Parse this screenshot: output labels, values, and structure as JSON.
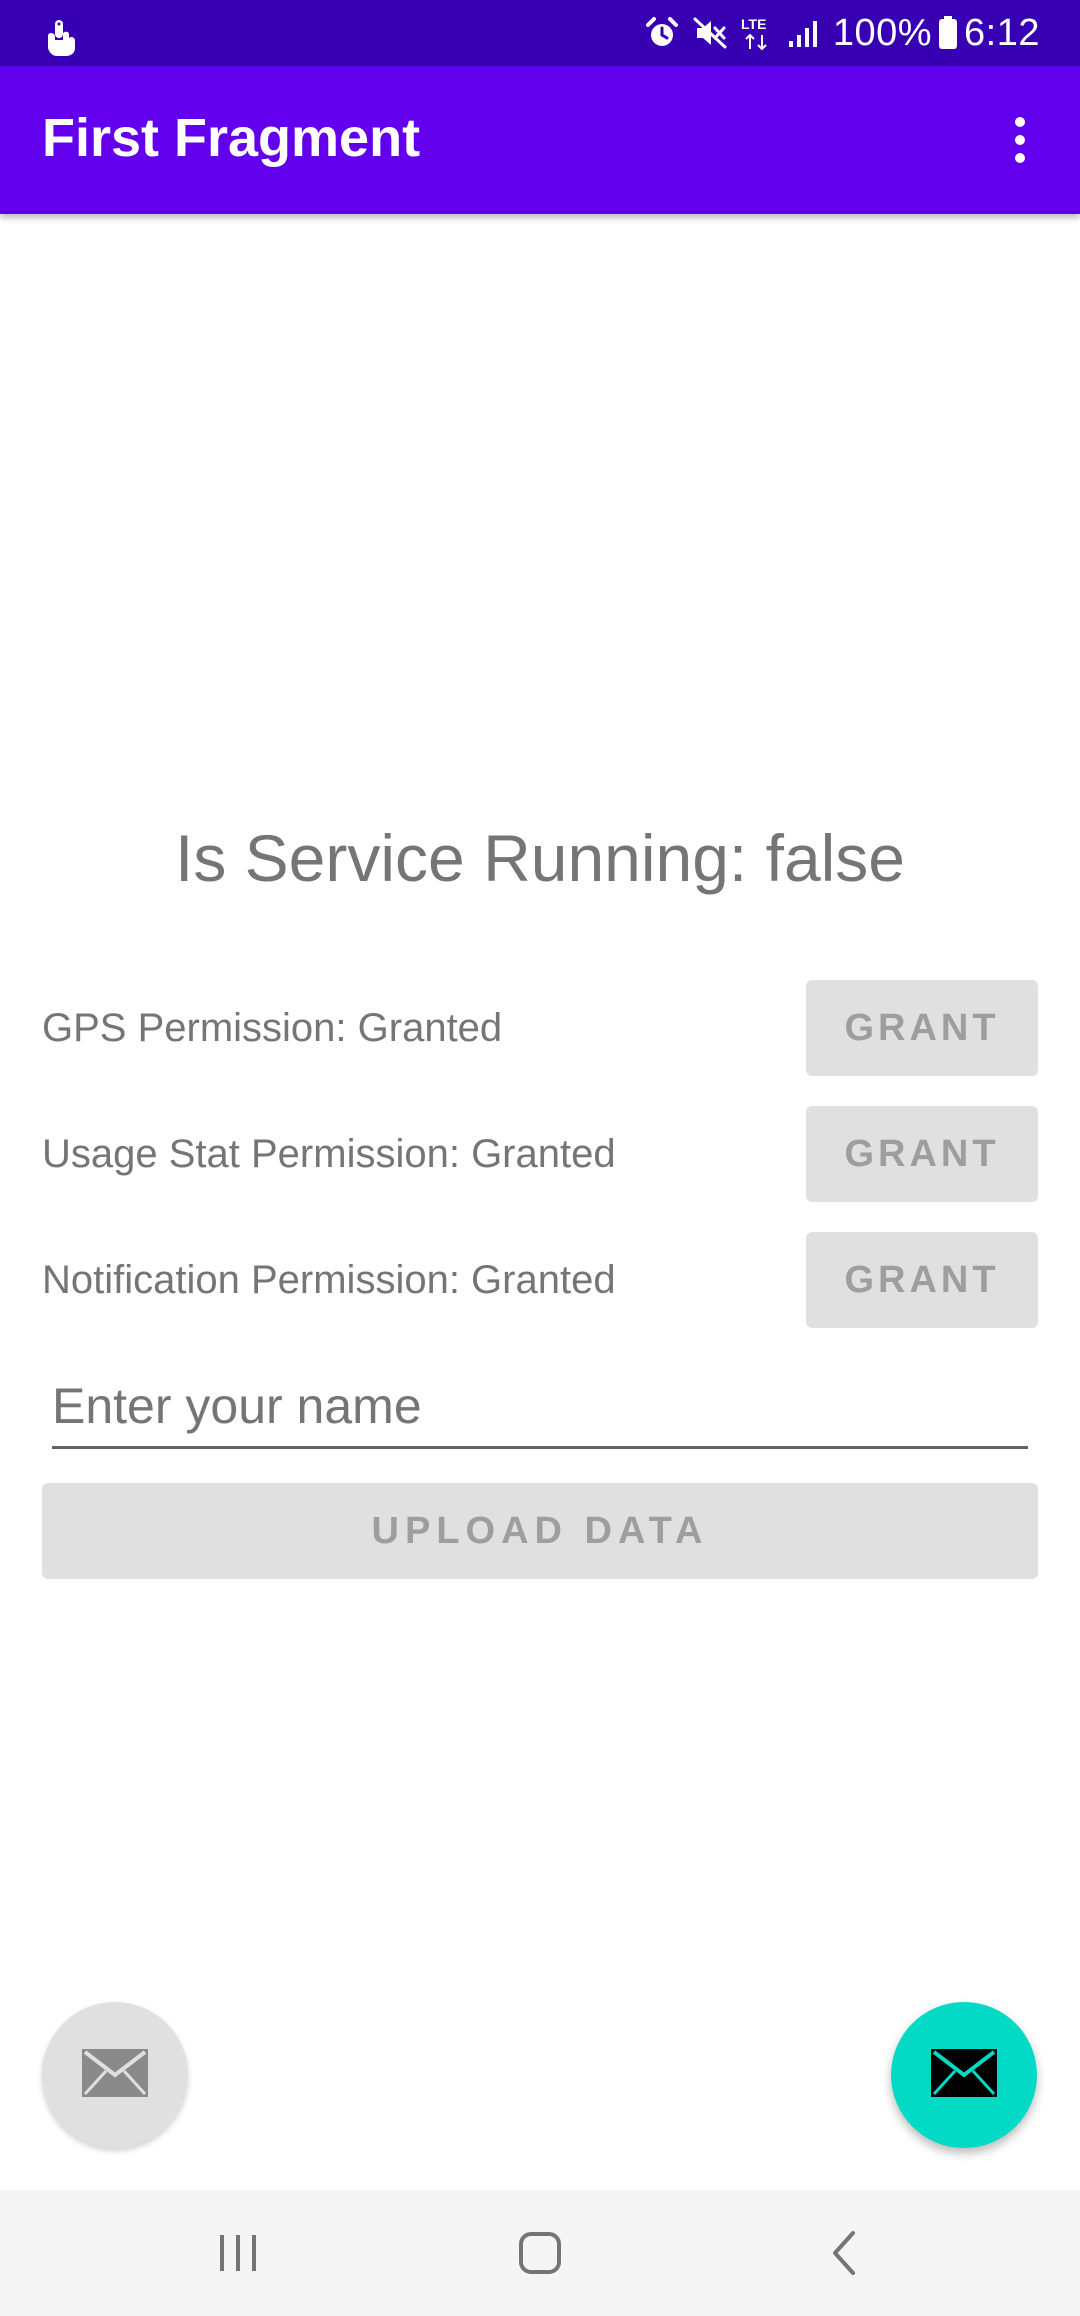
{
  "status_bar": {
    "battery": "100%",
    "time": "6:12",
    "network": "LTE",
    "icons": [
      "touch-hand-icon",
      "alarm-icon",
      "mute-icon",
      "lte-icon",
      "signal-icon",
      "battery-icon"
    ]
  },
  "app_bar": {
    "title": "First Fragment",
    "menu_icon": "overflow-menu-icon"
  },
  "main": {
    "service_status": "Is Service Running: false",
    "permissions": [
      {
        "label": "GPS Permission: Granted",
        "button": "GRANT"
      },
      {
        "label": "Usage Stat Permission: Granted",
        "button": "GRANT"
      },
      {
        "label": "Notification Permission: Granted",
        "button": "GRANT"
      }
    ],
    "name_input": {
      "value": "",
      "placeholder": "Enter your name"
    },
    "upload_button": "UPLOAD DATA"
  },
  "fabs": {
    "left_icon": "mail-icon",
    "right_icon": "mail-icon",
    "left_color": "#e0e0e0",
    "right_color": "#03dac5"
  },
  "nav_bar": {
    "icons": [
      "recent-apps-icon",
      "home-icon",
      "back-icon"
    ]
  },
  "colors": {
    "status_bar": "#3700b3",
    "primary": "#6200ee",
    "accent": "#03dac5"
  }
}
